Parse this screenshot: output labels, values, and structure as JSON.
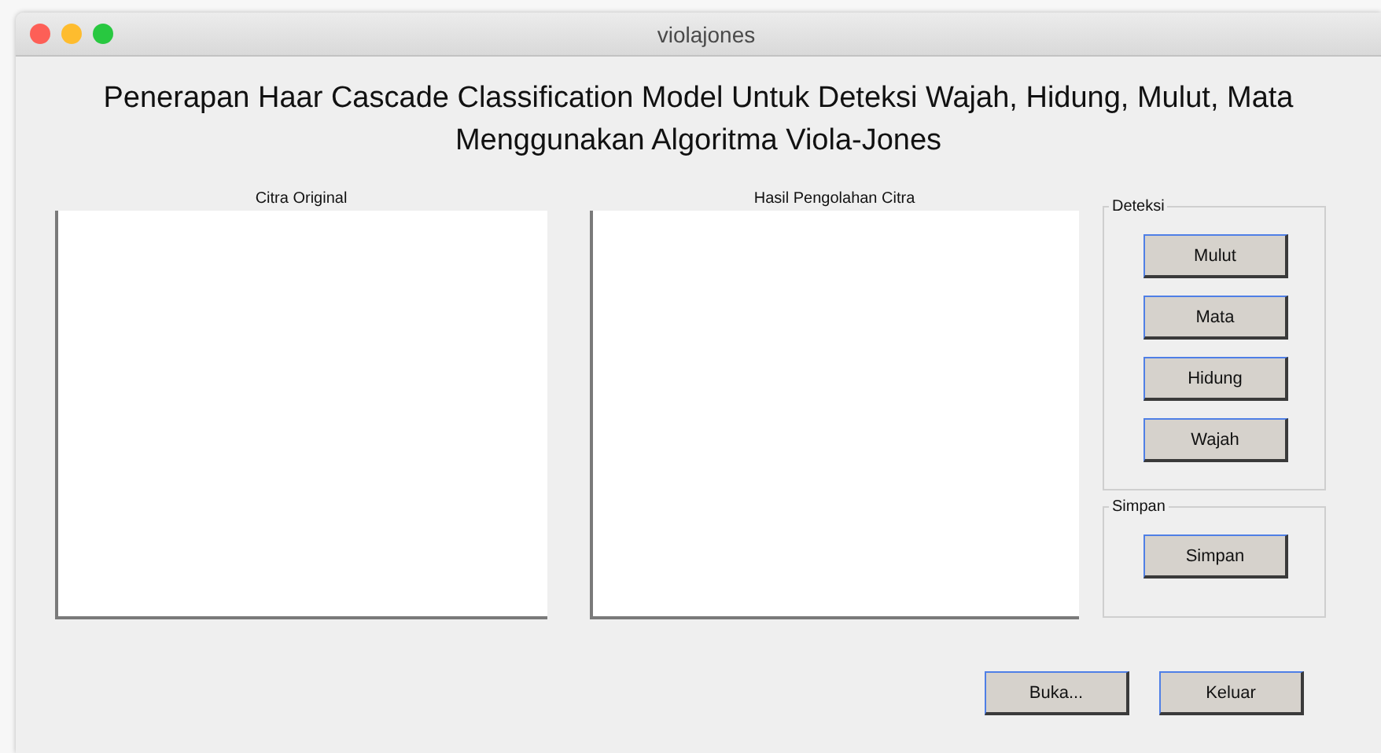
{
  "window": {
    "title": "violajones"
  },
  "heading": "Penerapan Haar Cascade Classification Model Untuk Deteksi Wajah, Hidung, Mulut, Mata Menggunakan Algoritma Viola-Jones",
  "axes": [
    {
      "label": "Citra Original"
    },
    {
      "label": "Hasil Pengolahan Citra"
    }
  ],
  "panels": [
    {
      "title": "Deteksi",
      "buttons": [
        "Mulut",
        "Mata",
        "Hidung",
        "Wajah"
      ]
    },
    {
      "title": "Simpan",
      "buttons": [
        "Simpan"
      ]
    }
  ],
  "buttons": [
    "Buka...",
    "Keluar"
  ]
}
